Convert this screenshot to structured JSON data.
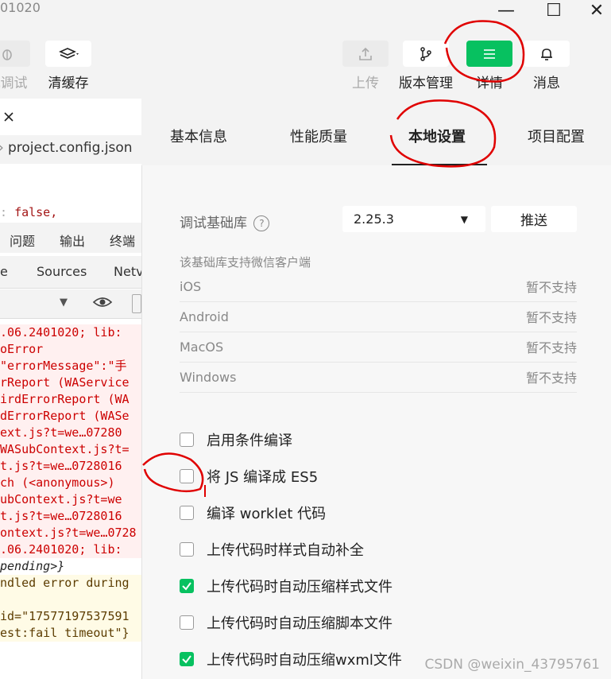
{
  "window": {
    "title": "01020",
    "buttons": [
      "—",
      "☐",
      "✕"
    ]
  },
  "toolbar": {
    "debug_label": "机调试",
    "clear_cache_label": "清缓存",
    "upload_label": "上传",
    "version_label": "版本管理",
    "details_label": "详情",
    "messages_label": "消息"
  },
  "editor": {
    "file_tab": "project.config.json",
    "code_value": "false,"
  },
  "devtools": {
    "tabs_top": [
      "问题",
      "输出",
      "终端"
    ],
    "tabs_bottom": [
      "e",
      "Sources",
      "Netv"
    ],
    "console": [
      {
        "text": ".06.2401020; lib:",
        "type": "err"
      },
      {
        "text": "oError",
        "type": "err"
      },
      {
        "text": "\"errorMessage\":\"手",
        "type": "err"
      },
      {
        "text": "rReport (WAService",
        "type": "err"
      },
      {
        "text": "irdErrorReport (WA",
        "type": "err"
      },
      {
        "text": "dErrorReport (WASe",
        "type": "err"
      },
      {
        "text": "ext.js?t=we…07280",
        "type": "err"
      },
      {
        "text": "WASubContext.js?t=",
        "type": "err"
      },
      {
        "text": "t.js?t=we…0728016",
        "type": "err"
      },
      {
        "text": "ch (<anonymous>)",
        "type": "err"
      },
      {
        "text": "ubContext.js?t=we",
        "type": "err"
      },
      {
        "text": "t.js?t=we…0728016",
        "type": "err"
      },
      {
        "text": "ontext.js?t=we…0728",
        "type": "err"
      },
      {
        "text": ".06.2401020; lib:",
        "type": "err"
      },
      {
        "text": "pending>}",
        "type": "plain"
      },
      {
        "text": "ndled error during",
        "type": "warn"
      },
      {
        "text": "",
        "type": "warn"
      },
      {
        "text": "id=\"17577197537591",
        "type": "warn"
      },
      {
        "text": "est:fail timeout\"}",
        "type": "warn"
      }
    ]
  },
  "panel": {
    "tabs": [
      "基本信息",
      "性能质量",
      "本地设置",
      "项目配置"
    ],
    "active_tab": 2,
    "lib_label": "调试基础库",
    "lib_value": "2.25.3",
    "push_label": "推送",
    "support_note": "该基础库支持微信客户端",
    "platforms": [
      {
        "name": "iOS",
        "status": "暂不支持"
      },
      {
        "name": "Android",
        "status": "暂不支持"
      },
      {
        "name": "MacOS",
        "status": "暂不支持"
      },
      {
        "name": "Windows",
        "status": "暂不支持"
      }
    ],
    "options": [
      {
        "label": "启用条件编译",
        "checked": false
      },
      {
        "label": "将 JS 编译成 ES5",
        "checked": false
      },
      {
        "label": "编译 worklet 代码",
        "checked": false
      },
      {
        "label": "上传代码时样式自动补全",
        "checked": false
      },
      {
        "label": "上传代码时自动压缩样式文件",
        "checked": true
      },
      {
        "label": "上传代码时自动压缩脚本文件",
        "checked": false
      },
      {
        "label": "上传代码时自动压缩wxml文件",
        "checked": true
      }
    ]
  },
  "watermark": "CSDN @weixin_43795761",
  "colors": {
    "accent": "#07c160",
    "annotation": "#e00000"
  }
}
